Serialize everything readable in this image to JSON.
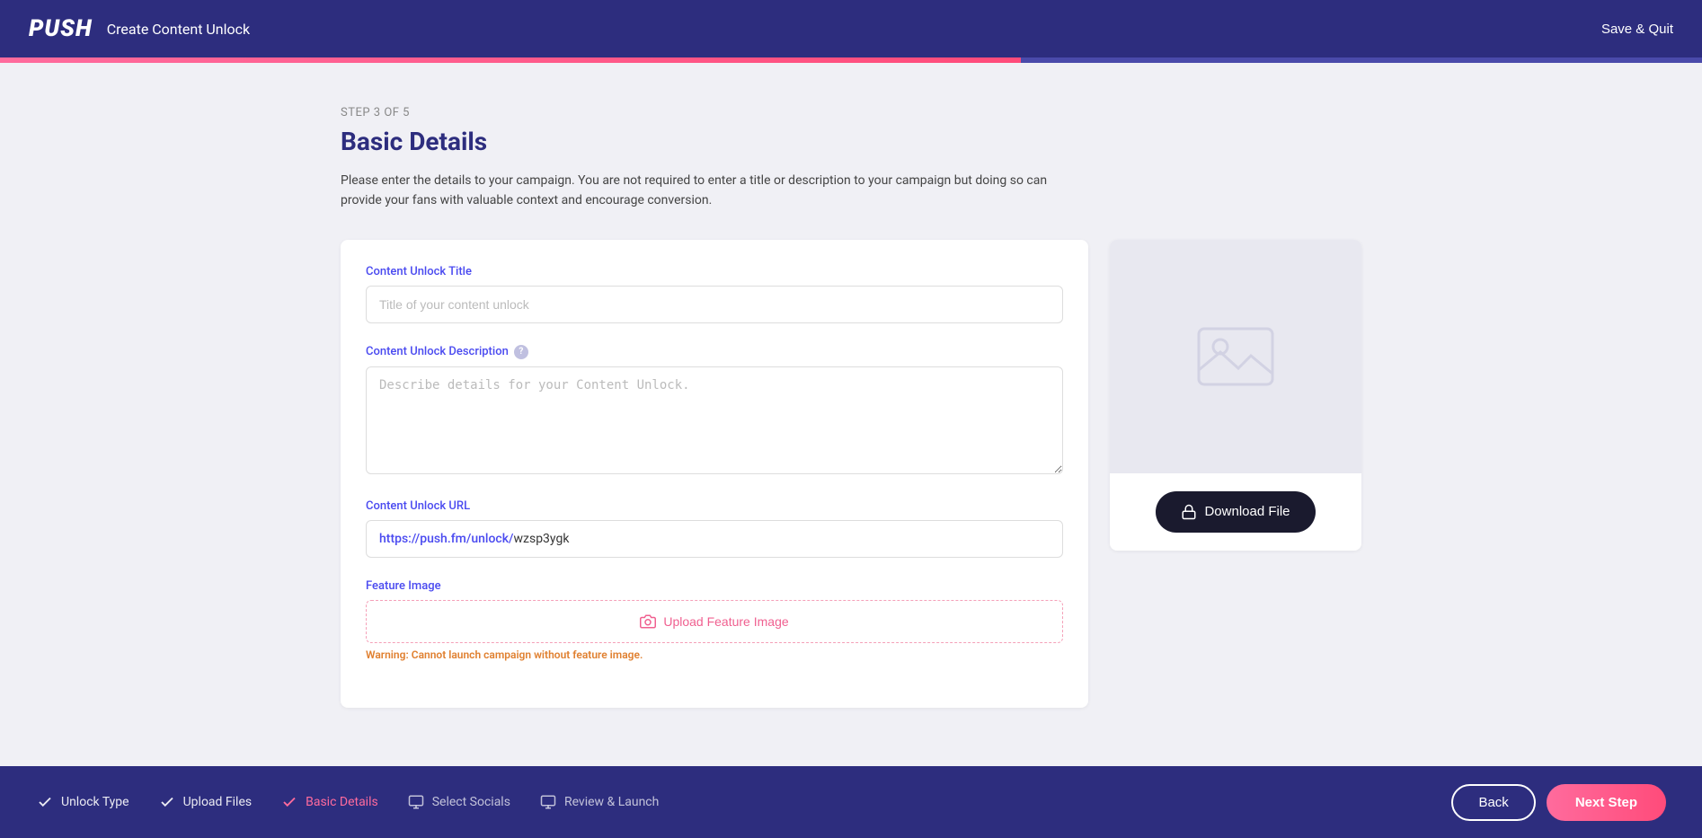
{
  "header": {
    "logo": "PUSH",
    "title": "Create Content Unlock",
    "save_quit_label": "Save & Quit"
  },
  "progress": {
    "percent": 60
  },
  "page": {
    "step_label": "STEP 3 OF 5",
    "heading": "Basic Details",
    "description": "Please enter the details to your campaign. You are not required to enter a title or description to your campaign but doing so can provide your fans with valuable context and encourage conversion."
  },
  "form": {
    "title_label": "Content Unlock Title",
    "title_placeholder": "Title of your content unlock",
    "description_label": "Content Unlock Description",
    "description_placeholder": "Describe details for your Content Unlock.",
    "url_label": "Content Unlock URL",
    "url_value": "https://push.fm/unlock/wzsp3ygk",
    "url_prefix": "https://push.fm/unlock/",
    "url_suffix": "wzsp3ygk",
    "feature_image_label": "Feature Image",
    "upload_label": "Upload Feature Image",
    "warning_label": "Warning:",
    "warning_message": " Cannot launch campaign without feature image."
  },
  "preview": {
    "download_btn_label": "Download File"
  },
  "footer": {
    "steps": [
      {
        "id": "unlock-type",
        "label": "Unlock Type",
        "state": "completed"
      },
      {
        "id": "upload-files",
        "label": "Upload Files",
        "state": "completed"
      },
      {
        "id": "basic-details",
        "label": "Basic Details",
        "state": "active"
      },
      {
        "id": "select-socials",
        "label": "Select Socials",
        "state": "inactive"
      },
      {
        "id": "review-launch",
        "label": "Review & Launch",
        "state": "inactive"
      }
    ],
    "back_label": "Back",
    "next_label": "Next Step"
  }
}
